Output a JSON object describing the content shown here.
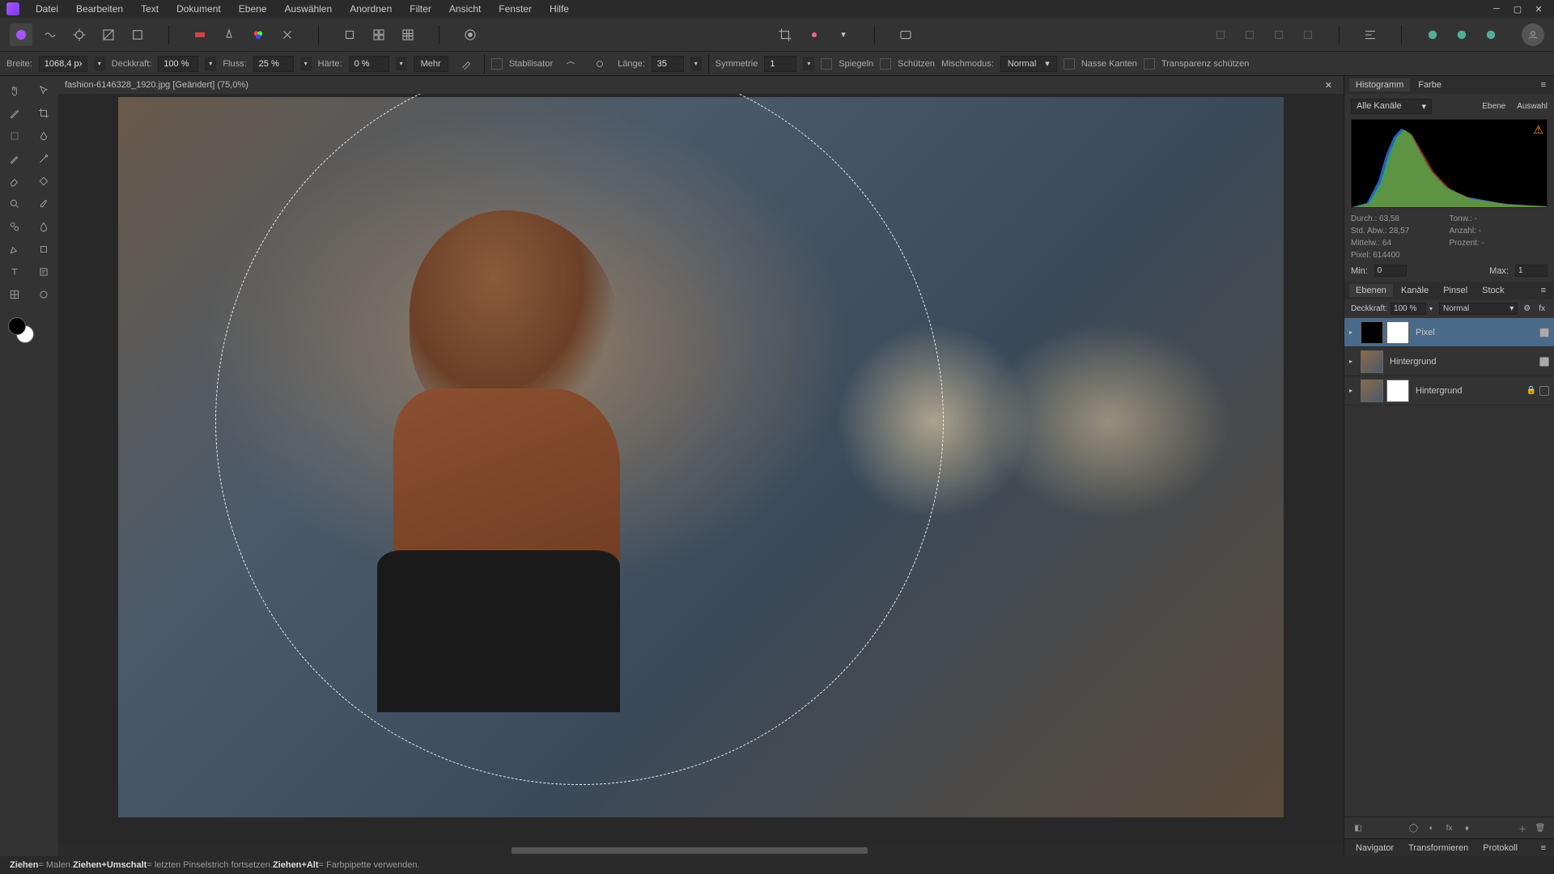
{
  "menubar": {
    "items": [
      "Datei",
      "Bearbeiten",
      "Text",
      "Dokument",
      "Ebene",
      "Auswählen",
      "Anordnen",
      "Filter",
      "Ansicht",
      "Fenster",
      "Hilfe"
    ]
  },
  "context": {
    "breite_label": "Breite:",
    "breite_value": "1068,4 px",
    "deckkraft_label": "Deckkraft:",
    "deckkraft_value": "100 %",
    "fluss_label": "Fluss:",
    "fluss_value": "25 %",
    "haerte_label": "Härte:",
    "haerte_value": "0 %",
    "mehr_label": "Mehr",
    "stabilisator_label": "Stabilisator",
    "laenge_label": "Länge:",
    "laenge_value": "35",
    "symmetrie_label": "Symmetrie",
    "symmetrie_value": "1",
    "spiegeln_label": "Spiegeln",
    "schuetzen_label": "Schützen",
    "mischmodus_label": "Mischmodus:",
    "mischmodus_value": "Normal",
    "nasse_label": "Nasse Kanten",
    "transparenz_label": "Transparenz schützen"
  },
  "document": {
    "tab_title": "fashion-6146328_1920.jpg [Geändert] (75,0%)"
  },
  "histogram": {
    "tab1": "Histogramm",
    "tab2": "Farbe",
    "channel_label": "Alle Kanäle",
    "btn_ebene": "Ebene",
    "btn_auswahl": "Auswahl",
    "stat_durch": "Durch.: 63,58",
    "stat_stdabw": "Std. Abw.: 28,57",
    "stat_mittelw": "Mittelw.: 64",
    "stat_pixel": "Pixel: 614400",
    "stat_tonw": "Tonw.: -",
    "stat_anzahl": "Anzahl: -",
    "stat_prozent": "Prozent: -",
    "min_label": "Min:",
    "min_value": "0",
    "max_label": "Max:",
    "max_value": "1"
  },
  "layers": {
    "tabs": [
      "Ebenen",
      "Kanäle",
      "Pinsel",
      "Stock"
    ],
    "deckkraft_label": "Deckkraft:",
    "deckkraft_value": "100 %",
    "blend_value": "Normal",
    "items": [
      {
        "name": "Pixel",
        "selected": true,
        "mask": "white",
        "thumb_black": true,
        "visible": true
      },
      {
        "name": "Hintergrund",
        "selected": false,
        "mask": "none",
        "visible": true
      },
      {
        "name": "Hintergrund",
        "selected": false,
        "mask": "white",
        "locked": true,
        "visible": false
      }
    ]
  },
  "bottom_panel": {
    "tabs": [
      "Navigator",
      "Transformieren",
      "Protokoll"
    ]
  },
  "statusbar": {
    "ziehen": "Ziehen",
    "malen": " = Malen. ",
    "ziehen_umschalt": "Ziehen+Umschalt",
    "pinsel": " = letzten Pinselstrich fortsetzen. ",
    "ziehen_alt": "Ziehen+Alt",
    "pipette": " = Farbpipette verwenden."
  }
}
